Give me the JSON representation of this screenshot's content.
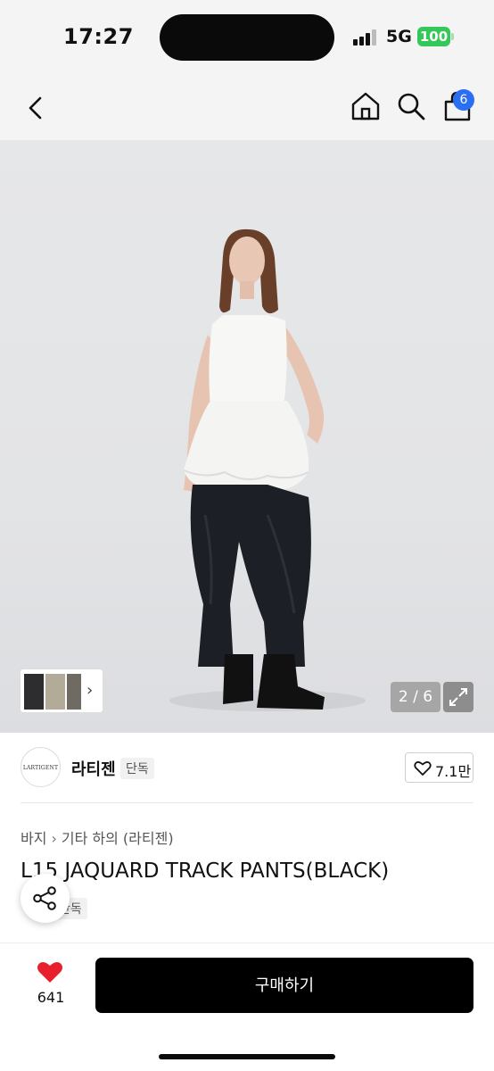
{
  "status": {
    "time": "17:27",
    "network": "5G",
    "battery": "100"
  },
  "header": {
    "cart_count": "6"
  },
  "gallery": {
    "counter": "2 / 6"
  },
  "brand": {
    "logo_text": "LARTIGENT",
    "name": "라티젠",
    "tag": "단독",
    "likes": "7.1만"
  },
  "breadcrumb": {
    "level1": "바지",
    "level2": "기타 하의 (라티젠)"
  },
  "product": {
    "title": "L15 JAQUARD TRACK PANTS(BLACK)",
    "tag": "단독"
  },
  "bottom": {
    "wish_count": "641",
    "buy_label": "구매하기"
  },
  "colors": {
    "accent_blue": "#2a6ef2",
    "battery_green": "#34c759",
    "heart_red": "#e8202e",
    "buy_button": "#000000"
  }
}
